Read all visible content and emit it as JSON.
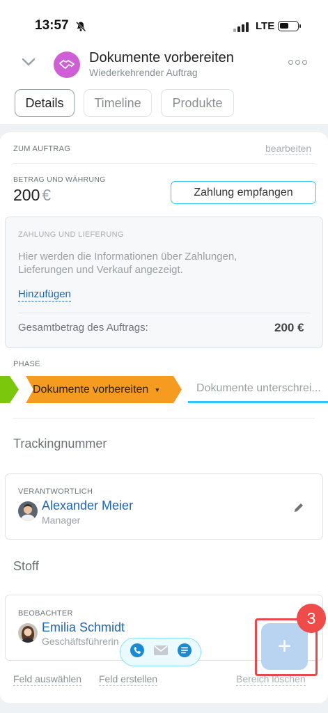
{
  "status_bar": {
    "time": "13:57",
    "network": "LTE"
  },
  "header": {
    "title": "Dokumente vorbereiten",
    "subtitle": "Wiederkehrender Auftrag",
    "tabs": [
      {
        "label": "Details",
        "active": true
      },
      {
        "label": "Timeline",
        "active": false
      },
      {
        "label": "Produkte",
        "active": false
      }
    ]
  },
  "order": {
    "section_label": "ZUM AUFTRAG",
    "edit_label": "bearbeiten",
    "amount_label": "BETRAG UND WÄHRUNG",
    "amount_value": "200",
    "currency": "€",
    "pay_button": "Zahlung empfangen"
  },
  "payment": {
    "label": "ZAHLUNG UND LIEFERUNG",
    "description": "Hier werden die Informationen über Zahlungen, Lieferungen und Verkauf angezeigt.",
    "add_link": "Hinzufügen",
    "total_label": "Gesamtbetrag des Auftrags:",
    "total_value": "200 €"
  },
  "phase": {
    "label": "PHASE",
    "current": "Dokumente vorbereiten",
    "next": "Dokumente unterschrei..."
  },
  "fields": {
    "tracking": "Trackingnummer",
    "responsible_label": "VERANTWORTLICH",
    "responsible_name": "Alexander Meier",
    "responsible_role": "Manager",
    "material": "Stoff",
    "observer_label": "BEOBACHTER",
    "observer_name": "Emilia Schmidt",
    "observer_role": "Geschäftsführerin"
  },
  "footer": {
    "select_field": "Feld auswählen",
    "create_field": "Feld erstellen",
    "delete_section": "Bereich löschen"
  },
  "badge_count": "3",
  "icons": [
    "bell-slash-icon",
    "chevron-down-icon",
    "handshake-icon",
    "more-icon",
    "caret-down-icon",
    "pencil-icon",
    "phone-icon",
    "mail-icon",
    "chat-icon",
    "plus-icon"
  ],
  "colors": {
    "accent": "#2fc6f6",
    "stage_active": "#f59b20",
    "stage_done": "#7ac70c",
    "link": "#2066b0",
    "badge": "#ef4b4b"
  }
}
